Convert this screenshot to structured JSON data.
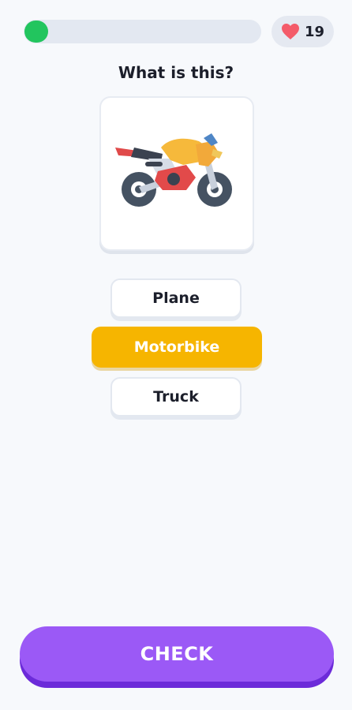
{
  "progress": {
    "fraction": 0.05,
    "color": "#22c55e"
  },
  "hearts": {
    "count": "19",
    "icon": "heart-icon",
    "color": "#f45b69"
  },
  "question": {
    "text": "What is this?"
  },
  "image": {
    "icon": "motorbike-illustration"
  },
  "options": [
    {
      "label": "Plane",
      "selected": false
    },
    {
      "label": "Motorbike",
      "selected": true
    },
    {
      "label": "Truck",
      "selected": false
    }
  ],
  "check_button": {
    "label": "CHECK",
    "color": "#9b59f6"
  },
  "colors": {
    "selected_option": "#f6b500",
    "background": "#f7f9fc"
  }
}
